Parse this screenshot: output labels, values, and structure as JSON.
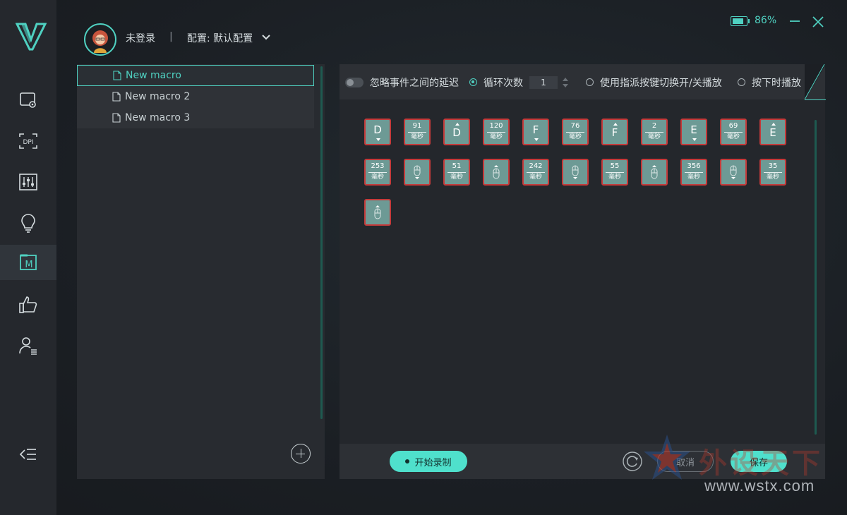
{
  "header": {
    "login_status": "未登录",
    "separator": "|",
    "profile_label": "配置: 默认配置",
    "battery_percent": "86%",
    "battery_level": 0.86
  },
  "rail": {
    "icons": [
      "monitor-settings-icon",
      "dpi-icon",
      "equalizer-icon",
      "lightbulb-icon",
      "macro-icon",
      "thumbs-up-icon",
      "user-list-icon",
      "collapse-menu-icon"
    ],
    "dpi_label": "DPI",
    "macro_label": "M"
  },
  "macros": [
    {
      "name": "New macro"
    },
    {
      "name": "New macro 2"
    },
    {
      "name": "New macro 3"
    }
  ],
  "toolbar": {
    "ignore_delay": "忽略事件之间的延迟",
    "loop_count": "循环次数",
    "loop_value": "1",
    "toggle_play": "使用指派按键切换开/关播放",
    "hold_play": "按下时播放"
  },
  "events_unit": "毫秒",
  "events": [
    {
      "type": "key",
      "label": "D",
      "dir": "down"
    },
    {
      "type": "delay",
      "value": "91"
    },
    {
      "type": "key",
      "label": "D",
      "dir": "up"
    },
    {
      "type": "delay",
      "value": "120"
    },
    {
      "type": "key",
      "label": "F",
      "dir": "down"
    },
    {
      "type": "delay",
      "value": "76"
    },
    {
      "type": "key",
      "label": "F",
      "dir": "up"
    },
    {
      "type": "delay",
      "value": "2"
    },
    {
      "type": "key",
      "label": "E",
      "dir": "down"
    },
    {
      "type": "delay",
      "value": "69"
    },
    {
      "type": "key",
      "label": "E",
      "dir": "up"
    },
    {
      "type": "delay",
      "value": "253"
    },
    {
      "type": "mouse",
      "dir": "down"
    },
    {
      "type": "delay",
      "value": "51"
    },
    {
      "type": "mouse",
      "dir": "up"
    },
    {
      "type": "delay",
      "value": "242"
    },
    {
      "type": "mouse",
      "dir": "down"
    },
    {
      "type": "delay",
      "value": "55"
    },
    {
      "type": "mouse",
      "dir": "up"
    },
    {
      "type": "delay",
      "value": "356"
    },
    {
      "type": "mouse",
      "dir": "down"
    },
    {
      "type": "delay",
      "value": "35"
    },
    {
      "type": "mouse",
      "dir": "up"
    }
  ],
  "buttons": {
    "record": "开始录制",
    "cancel": "取消",
    "save": "保存"
  },
  "watermark": {
    "cn": "外设天下",
    "url": "www.wstx.com"
  },
  "colors": {
    "accent": "#4fd1c1",
    "event_fill": "#6d9a95",
    "event_border": "#c43a3a"
  }
}
